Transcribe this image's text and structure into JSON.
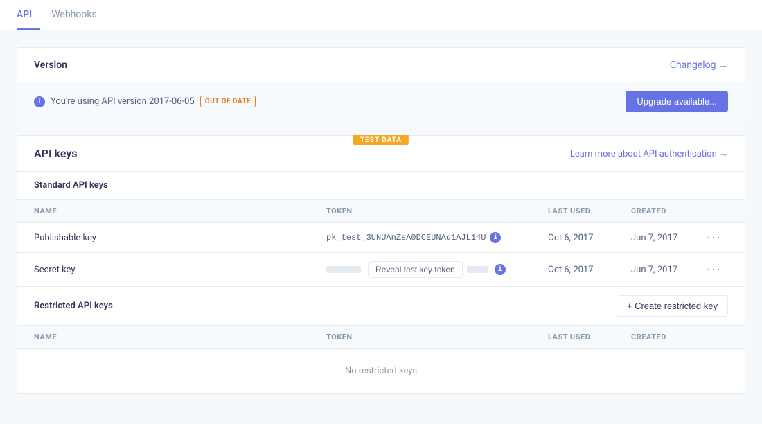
{
  "nav": {
    "tabs": [
      {
        "id": "api",
        "label": "API",
        "active": true
      },
      {
        "id": "webhooks",
        "label": "Webhooks",
        "active": false
      }
    ]
  },
  "version_card": {
    "section_title": "Version",
    "changelog_label": "Changelog →",
    "version_info": "You're using API version 2017-06-05",
    "out_of_date_badge": "OUT OF DATE",
    "upgrade_button": "Upgrade available..."
  },
  "api_keys_card": {
    "test_data_label": "TEST DATA",
    "title": "API keys",
    "learn_more_label": "Learn more about API authentication →",
    "standard_section_title": "Standard API keys",
    "columns": {
      "name": "NAME",
      "token": "TOKEN",
      "last_used": "LAST USED",
      "created": "CREATED"
    },
    "standard_keys": [
      {
        "name": "Publishable key",
        "token": "pk_test_3UNUAnZsA0DCEUNAq1AJL14U",
        "token_type": "visible",
        "last_used": "Oct 6, 2017",
        "created": "Jun 7, 2017"
      },
      {
        "name": "Secret key",
        "token": "",
        "token_type": "masked",
        "reveal_label": "Reveal test key token",
        "last_used": "Oct 6, 2017",
        "created": "Jun 7, 2017"
      }
    ],
    "restricted_section_title": "Restricted API keys",
    "create_restricted_label": "+ Create restricted key",
    "no_restricted_keys": "No restricted keys"
  }
}
